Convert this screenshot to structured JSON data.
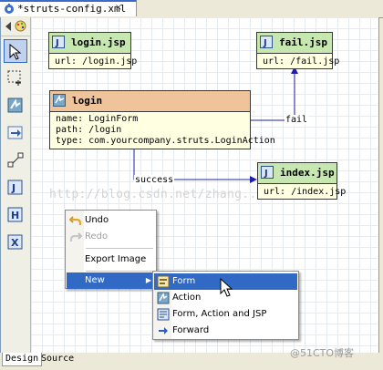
{
  "editor": {
    "tab_title": "*struts-config.xml",
    "tab_close": "×",
    "tab_icon": "struts-config-icon"
  },
  "palette": {
    "items": [
      {
        "name": "select-tool-icon",
        "selected": true
      },
      {
        "name": "marquee-tool-icon",
        "selected": false
      },
      {
        "name": "action-tool-icon",
        "selected": false
      },
      {
        "name": "forward-tool-icon",
        "selected": false
      },
      {
        "name": "connection-tool-icon",
        "selected": false
      },
      {
        "name": "jsp-tool-icon",
        "selected": false
      },
      {
        "name": "html-tool-icon",
        "selected": false
      },
      {
        "name": "exception-tool-icon",
        "selected": false
      }
    ]
  },
  "diagram": {
    "login_jsp": {
      "title": "login.jsp",
      "url": "url: /login.jsp"
    },
    "fail_jsp": {
      "title": "fail.jsp",
      "url": "url: /fail.jsp"
    },
    "login_action": {
      "title": "login",
      "name": "name: LoginForm",
      "path": "path: /login",
      "type": "type: com.yourcompany.struts.LoginAction"
    },
    "index_jsp": {
      "title": "index.jsp",
      "url": "url: /index.jsp"
    },
    "edge_fail": "fail",
    "edge_success": "success",
    "watermark": "http://blog.csdn.net/zhang...24",
    "colors": {
      "jsp_header": "#c7e7b0",
      "action_header": "#f0c49a",
      "body": "#ffffe1",
      "edge": "#1f1fa8"
    }
  },
  "context_menu": {
    "items": [
      {
        "label": "Undo",
        "icon": "undo-icon",
        "enabled": true
      },
      {
        "label": "Redo",
        "icon": "redo-icon",
        "enabled": false
      },
      {
        "label": "Export Image",
        "enabled": true
      },
      {
        "label": "New",
        "enabled": true,
        "highlighted": true
      }
    ]
  },
  "submenu": {
    "items": [
      {
        "label": "Form",
        "icon": "form-icon",
        "highlighted": true
      },
      {
        "label": "Action",
        "icon": "action-icon"
      },
      {
        "label": "Form, Action and JSP",
        "icon": "form-action-jsp-icon"
      },
      {
        "label": "Forward",
        "icon": "forward-icon"
      }
    ]
  },
  "bottom_tabs": {
    "design": "Design",
    "source": "Source",
    "active": "Design"
  },
  "footer_watermark": "@51CTO博客",
  "accent_color": "#316ac5"
}
